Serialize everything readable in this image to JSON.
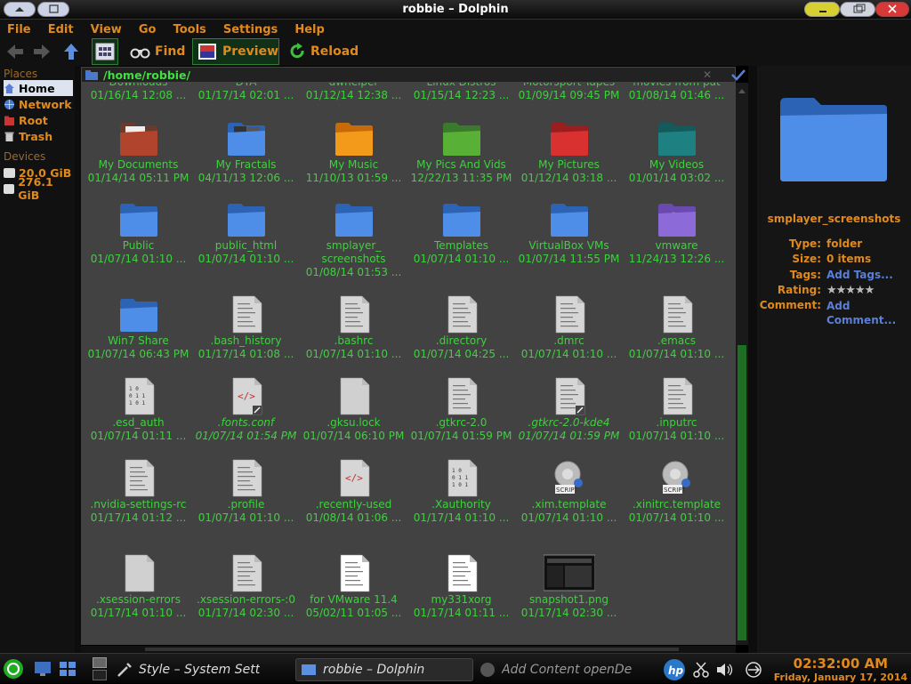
{
  "window": {
    "title": "robbie – Dolphin"
  },
  "menu": [
    "File",
    "Edit",
    "View",
    "Go",
    "Tools",
    "Settings",
    "Help"
  ],
  "toolbar": {
    "find": "Find",
    "preview": "Preview",
    "reload": "Reload"
  },
  "places": {
    "title": "Places",
    "items": [
      {
        "label": "Home",
        "selected": true,
        "icon": "home-icon"
      },
      {
        "label": "Network",
        "icon": "network-icon"
      },
      {
        "label": "Root",
        "icon": "root-icon"
      },
      {
        "label": "Trash",
        "icon": "trash-icon"
      }
    ],
    "devices_title": "Devices",
    "devices": [
      "20.0 GiB H",
      "276.1 GiB"
    ]
  },
  "location": {
    "path": "/home/robbie/"
  },
  "files": [
    {
      "name": "Downloads",
      "date": "01/16/14 12:08 ...",
      "icon": "folder"
    },
    {
      "name": "DTA",
      "date": "01/17/14 02:01 ...",
      "icon": "folder"
    },
    {
      "name": "dwhelper",
      "date": "01/12/14 12:38 ...",
      "icon": "folder"
    },
    {
      "name": "Linux Distros",
      "date": "01/15/14 12:23 ...",
      "icon": "folder"
    },
    {
      "name": "Motorsport Tapes",
      "date": "01/09/14 09:45 PM",
      "icon": "folder"
    },
    {
      "name": "movies from pat",
      "date": "01/08/14 01:46 ...",
      "icon": "folder"
    },
    {
      "name": "My Documents",
      "date": "01/14/14 05:11 PM",
      "icon": "folder-docs"
    },
    {
      "name": "My Fractals",
      "date": "04/11/13 12:06 ...",
      "icon": "folder-pics"
    },
    {
      "name": "My Music",
      "date": "11/10/13 01:59 ...",
      "icon": "folder-music"
    },
    {
      "name": "My Pics And Vids",
      "date": "12/22/13 11:35 PM",
      "icon": "folder-green"
    },
    {
      "name": "My Pictures",
      "date": "01/12/14 03:18 ...",
      "icon": "folder-red"
    },
    {
      "name": "My Videos",
      "date": "01/01/14 03:02 ...",
      "icon": "folder-teal"
    },
    {
      "name": "Public",
      "date": "01/07/14 01:10 ...",
      "icon": "folder"
    },
    {
      "name": "public_html",
      "date": "01/07/14 01:10 ...",
      "icon": "folder-html"
    },
    {
      "name": "smplayer_ screenshots",
      "date": "01/08/14 01:53 ...",
      "icon": "folder"
    },
    {
      "name": "Templates",
      "date": "01/07/14 01:10 ...",
      "icon": "folder"
    },
    {
      "name": "VirtualBox VMs",
      "date": "01/07/14 11:55 PM",
      "icon": "folder"
    },
    {
      "name": "vmware",
      "date": "11/24/13 12:26 ...",
      "icon": "folder-vm"
    },
    {
      "name": "Win7 Share",
      "date": "01/07/14 06:43 PM",
      "icon": "folder"
    },
    {
      "name": ".bash_history",
      "date": "01/17/14 01:08 ...",
      "icon": "text"
    },
    {
      "name": ".bashrc",
      "date": "01/07/14 01:10 ...",
      "icon": "text"
    },
    {
      "name": ".directory",
      "date": "01/07/14 04:25 ...",
      "icon": "text"
    },
    {
      "name": ".dmrc",
      "date": "01/07/14 01:10 ...",
      "icon": "text"
    },
    {
      "name": ".emacs",
      "date": "01/07/14 01:10 ...",
      "icon": "text"
    },
    {
      "name": ".esd_auth",
      "date": "01/07/14 01:11 ...",
      "icon": "binary"
    },
    {
      "name": ".fonts.conf",
      "date": "01/07/14 01:54 PM",
      "icon": "xml-link",
      "italic": true
    },
    {
      "name": ".gksu.lock",
      "date": "01/07/14 06:10 PM",
      "icon": "blank"
    },
    {
      "name": ".gtkrc-2.0",
      "date": "01/07/14 01:59 PM",
      "icon": "text"
    },
    {
      "name": ".gtkrc-2.0-kde4",
      "date": "01/07/14 01:59 PM",
      "icon": "text-link",
      "italic": true
    },
    {
      "name": ".inputrc",
      "date": "01/07/14 01:10 ...",
      "icon": "text"
    },
    {
      "name": ".nvidia-settings-rc",
      "date": "01/17/14 01:12 ...",
      "icon": "text"
    },
    {
      "name": ".profile",
      "date": "01/07/14 01:10 ...",
      "icon": "text"
    },
    {
      "name": ".recently-used",
      "date": "01/08/14 01:06 ...",
      "icon": "xml"
    },
    {
      "name": ".Xauthority",
      "date": "01/17/14 01:10 ...",
      "icon": "binary"
    },
    {
      "name": ".xim.template",
      "date": "01/07/14 01:10 ...",
      "icon": "script"
    },
    {
      "name": ".xinitrc.template",
      "date": "01/07/14 01:10 ...",
      "icon": "script"
    },
    {
      "name": ".xsession-errors",
      "date": "01/17/14 01:10 ...",
      "icon": "blank"
    },
    {
      "name": ".xsession-errors-:0",
      "date": "01/17/14 02:30 ...",
      "icon": "text"
    },
    {
      "name": "for VMware 11.4",
      "date": "05/02/11 01:05 ...",
      "icon": "text-white"
    },
    {
      "name": "my331xorg",
      "date": "01/17/14 01:11 ...",
      "icon": "text-white"
    },
    {
      "name": "snapshot1.png",
      "date": "01/17/14 02:30 ...",
      "icon": "image"
    }
  ],
  "info": {
    "name": "smplayer_screenshots",
    "type_label": "Type:",
    "type_value": "folder",
    "size_label": "Size:",
    "size_value": "0 items",
    "tags_label": "Tags:",
    "tags_value": "Add Tags...",
    "rating_label": "Rating:",
    "rating_value": 0,
    "comment_label": "Comment:",
    "comment_value": "Add Comment..."
  },
  "taskbar": {
    "tasks": [
      "Style – System Sett",
      "robbie – Dolphin",
      "Add Content openDe"
    ],
    "time": "02:32:00 AM",
    "date": "Friday, January 17, 2014"
  }
}
